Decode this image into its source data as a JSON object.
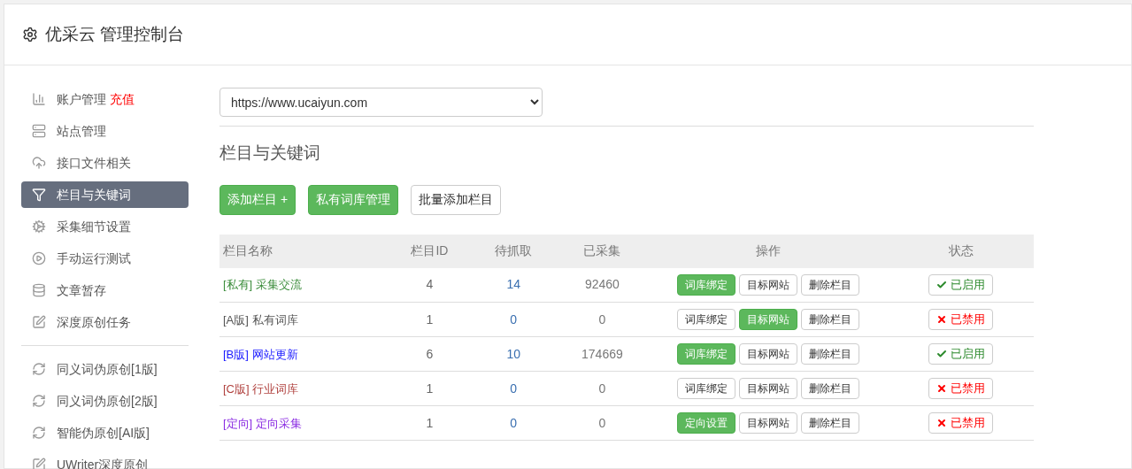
{
  "header": {
    "title": "优采云 管理控制台"
  },
  "sidebar": {
    "items": [
      {
        "label": "账户管理",
        "badge": "充值",
        "selected": false
      },
      {
        "label": "站点管理",
        "selected": false
      },
      {
        "label": "接口文件相关",
        "selected": false
      },
      {
        "label": "栏目与关键词",
        "selected": true
      },
      {
        "label": "采集细节设置",
        "selected": false
      },
      {
        "label": "手动运行测试",
        "selected": false
      },
      {
        "label": "文章暂存",
        "selected": false
      },
      {
        "label": "深度原创任务",
        "selected": false
      }
    ],
    "items_2": [
      {
        "label": "同义词伪原创[1版]",
        "selected": false
      },
      {
        "label": "同义词伪原创[2版]",
        "selected": false
      },
      {
        "label": "智能伪原创[AI版]",
        "selected": false
      },
      {
        "label": "UWriter深度原创",
        "selected": false
      }
    ]
  },
  "site_select": {
    "value": "https://www.ucaiyun.com"
  },
  "section": {
    "title": "栏目与关键词",
    "buttons": [
      {
        "label": "添加栏目 +",
        "kind": "primary"
      },
      {
        "label": "私有词库管理",
        "kind": "primary"
      },
      {
        "label": "批量添加栏目",
        "kind": "default"
      }
    ]
  },
  "table": {
    "columns": [
      "栏目名称",
      "栏目ID",
      "待抓取",
      "已采集",
      "操作",
      "状态"
    ],
    "rows": [
      {
        "name": "[私有] 采集交流",
        "color": "#3c8d3c",
        "id": "4",
        "pending": "14",
        "collected": "92460",
        "actions": [
          {
            "label": "词库绑定",
            "kind": "primary"
          },
          {
            "label": "目标网站",
            "kind": "default"
          },
          {
            "label": "删除栏目",
            "kind": "default"
          }
        ],
        "status": "已启用",
        "enabled": true
      },
      {
        "name": "[A版] 私有词库",
        "color": "#555555",
        "id": "1",
        "pending": "0",
        "collected": "0",
        "actions": [
          {
            "label": "词库绑定",
            "kind": "default"
          },
          {
            "label": "目标网站",
            "kind": "primary"
          },
          {
            "label": "删除栏目",
            "kind": "default"
          }
        ],
        "status": "已禁用",
        "enabled": false
      },
      {
        "name": "[B版] 网站更新",
        "color": "#1a1aff",
        "id": "6",
        "pending": "10",
        "collected": "174669",
        "actions": [
          {
            "label": "词库绑定",
            "kind": "primary"
          },
          {
            "label": "目标网站",
            "kind": "default"
          },
          {
            "label": "删除栏目",
            "kind": "default"
          }
        ],
        "status": "已启用",
        "enabled": true
      },
      {
        "name": "[C版] 行业词库",
        "color": "#b0413e",
        "id": "1",
        "pending": "0",
        "collected": "0",
        "actions": [
          {
            "label": "词库绑定",
            "kind": "default"
          },
          {
            "label": "目标网站",
            "kind": "default"
          },
          {
            "label": "删除栏目",
            "kind": "default"
          }
        ],
        "status": "已禁用",
        "enabled": false
      },
      {
        "name": "[定向] 定向采集",
        "color": "#8a2be2",
        "id": "1",
        "pending": "0",
        "collected": "0",
        "actions": [
          {
            "label": "定向设置",
            "kind": "primary"
          },
          {
            "label": "目标网站",
            "kind": "default"
          },
          {
            "label": "删除栏目",
            "kind": "default"
          }
        ],
        "status": "已禁用",
        "enabled": false
      }
    ]
  }
}
